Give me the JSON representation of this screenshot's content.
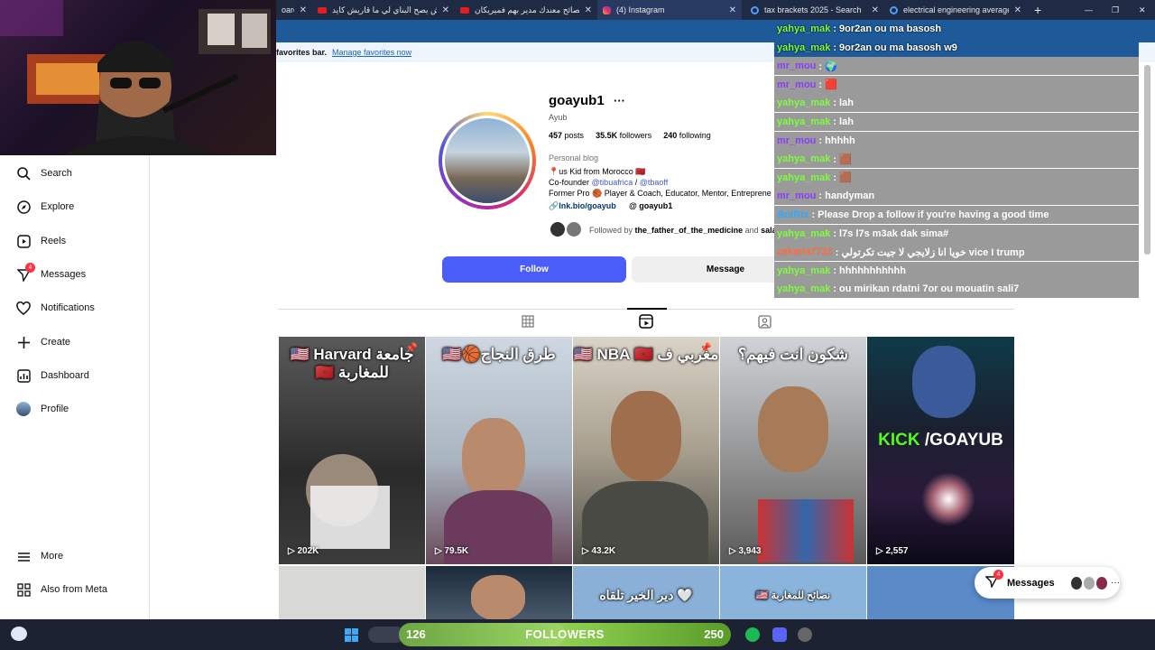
{
  "browser": {
    "tabs": [
      {
        "label": "oard",
        "icon": "youtube-icon"
      },
      {
        "label": "واش يصح البناي لي ما قاريش كايد...",
        "icon": "youtube-icon"
      },
      {
        "label": "نصائح معندك مدير بهم فميريكان",
        "icon": "youtube-icon"
      },
      {
        "label": "(4) Instagram",
        "icon": "instagram-icon"
      },
      {
        "label": "tax brackets 2025 - Search",
        "icon": "edge-icon"
      },
      {
        "label": "electrical engineering average sa",
        "icon": "edge-icon"
      }
    ],
    "favorites_label": "favorites bar.",
    "favorites_link": "Manage favorites now"
  },
  "sidebar": {
    "items": [
      {
        "label": "Search",
        "icon": "search-icon"
      },
      {
        "label": "Explore",
        "icon": "compass-icon"
      },
      {
        "label": "Reels",
        "icon": "reels-icon"
      },
      {
        "label": "Messages",
        "icon": "messenger-icon",
        "badge": "4"
      },
      {
        "label": "Notifications",
        "icon": "heart-icon"
      },
      {
        "label": "Create",
        "icon": "plus-icon"
      },
      {
        "label": "Dashboard",
        "icon": "dashboard-icon"
      },
      {
        "label": "Profile",
        "icon": "avatar-icon"
      },
      {
        "label": "More",
        "icon": "menu-icon"
      },
      {
        "label": "Also from Meta",
        "icon": "meta-icon"
      }
    ]
  },
  "profile": {
    "username": "goayub1",
    "name": "Ayub",
    "posts": "457",
    "posts_label": "posts",
    "followers": "35.5K",
    "followers_label": "followers",
    "following": "240",
    "following_label": "following",
    "category": "Personal blog",
    "bio_line1": "📍us Kid from Morocco 🇲🇦",
    "bio_line2_prefix": "Co-founder",
    "bio_mention1": "@tibuafrica",
    "bio_sep": "/",
    "bio_mention2": "@tbaoff",
    "bio_line3": "Former Pro 🏀 Player & Coach, Educator, Mentor, Entreprene",
    "link": "lnk.bio/goayub",
    "threads": "goayub1",
    "followed_by_prefix": "Followed by",
    "followed_by_user": "the_father_of_the_medicine",
    "followed_by_and": "and",
    "followed_by_more": "salah",
    "follow_button": "Follow",
    "message_button": "Message"
  },
  "tabs": [
    {
      "name": "posts",
      "icon": "grid-icon"
    },
    {
      "name": "reels",
      "icon": "reels-icon",
      "active": true
    },
    {
      "name": "tagged",
      "icon": "tagged-icon"
    }
  ],
  "grid": [
    {
      "title": "🇺🇸 Harvard جامعة 🇲🇦 للمغاربة",
      "views": "202K",
      "pinned": true
    },
    {
      "title": "🇺🇸🏀طرق النجاح",
      "views": "79.5K",
      "pinned": false
    },
    {
      "title": "🇺🇸 NBA 🇲🇦 مغربي ف",
      "views": "43.2K",
      "pinned": true
    },
    {
      "title": "شكون انت فيهم؟",
      "views": "3,943",
      "pinned": false
    },
    {
      "title": "KICK /GOAYUB",
      "views": "2,557",
      "pinned": false
    },
    {
      "title": "",
      "views": ""
    },
    {
      "title": "",
      "views": ""
    },
    {
      "title": "دير الخير تلقاه 🤍",
      "views": ""
    },
    {
      "title": "🇺🇸 نصائح للمغاربة",
      "views": ""
    },
    {
      "title": "",
      "views": ""
    }
  ],
  "chat": [
    {
      "user": "yahya_mak",
      "color": "#7cff3a",
      "text": ": 9or2an ou ma basosh",
      "plain": true
    },
    {
      "user": "yahya_mak",
      "color": "#7cff3a",
      "text": ": 9or2an ou ma basosh w9",
      "plain": true
    },
    {
      "user": "mr_mou",
      "color": "#8a3cff",
      "text": ": 🌍"
    },
    {
      "user": "mr_mou",
      "color": "#8a3cff",
      "text": ": 🟥"
    },
    {
      "user": "yahya_mak",
      "color": "#7cff3a",
      "text": ": lah"
    },
    {
      "user": "yahya_mak",
      "color": "#7cff3a",
      "text": ": lah"
    },
    {
      "user": "mr_mou",
      "color": "#8a3cff",
      "text": ": hhhhh"
    },
    {
      "user": "yahya_mak",
      "color": "#7cff3a",
      "text": ": 🟫"
    },
    {
      "user": "yahya_mak",
      "color": "#7cff3a",
      "text": ": 🟫"
    },
    {
      "user": "mr_mou",
      "color": "#8a3cff",
      "text": ": handyman"
    },
    {
      "user": "BotRix",
      "color": "#2fa8ff",
      "text": ": Please Drop a follow if you're having a good time"
    },
    {
      "user": "yahya_mak",
      "color": "#7cff3a",
      "text": ": l7s l7s m3ak dak sima#"
    },
    {
      "user": "zakaria7721",
      "color": "#ff6a3c",
      "text": ": خويا انا زلايجي لا جيت تكرتولي vice I trump"
    },
    {
      "user": "yahya_mak",
      "color": "#7cff3a",
      "text": ": hhhhhhhhhhh"
    },
    {
      "user": "yahya_mak",
      "color": "#7cff3a",
      "text": ": ou mirikan rdatni 7or ou mouatin sali7"
    }
  ],
  "messages_pill": {
    "label": "Messages",
    "badge": "4"
  },
  "followers_bar": {
    "current": "126",
    "label": "FOLLOWERS",
    "goal": "250",
    "progress": 0.504
  }
}
